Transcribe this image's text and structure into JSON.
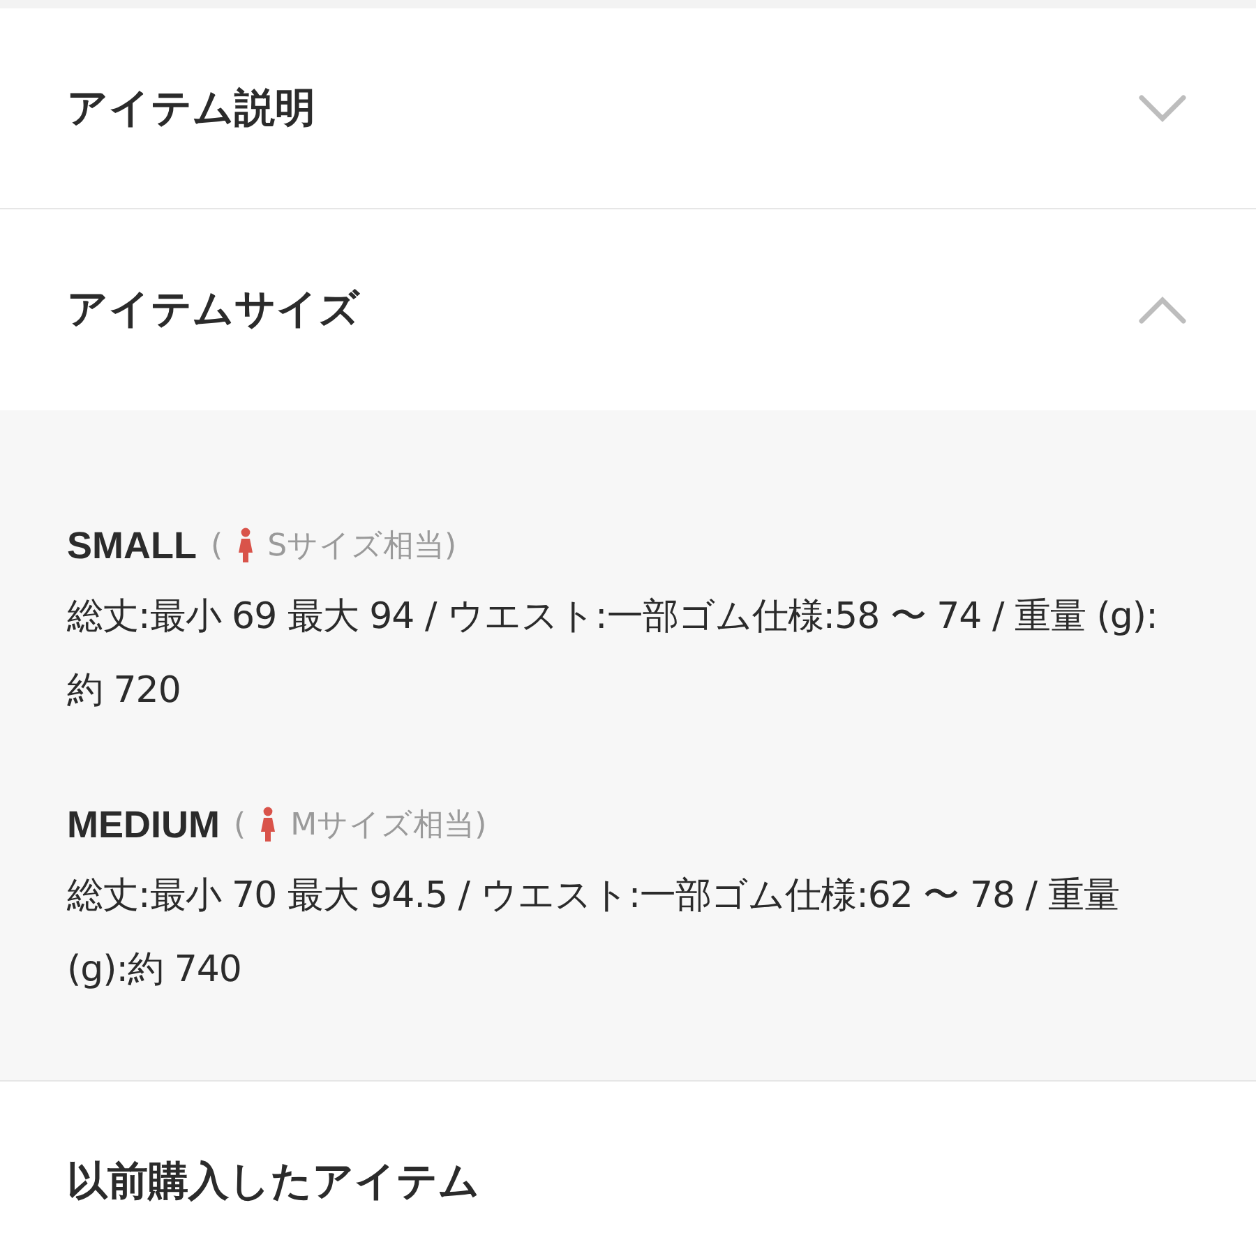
{
  "sections": [
    {
      "title": "アイテム説明",
      "expanded": false
    },
    {
      "title": "アイテムサイズ",
      "expanded": true,
      "sizes": [
        {
          "name": "SMALL",
          "note_open": "(",
          "note": "Sサイズ相当)",
          "details": "総丈:最小 69 最大 94 / ウエスト:一部ゴム仕様:58 〜 74 / 重量 (g):約 720"
        },
        {
          "name": "MEDIUM",
          "note_open": "(",
          "note": "Mサイズ相当)",
          "details": "総丈:最小 70 最大 94.5 / ウエスト:一部ゴム仕様:62 〜 78 / 重量 (g):約 740"
        }
      ]
    },
    {
      "title": "以前購入したアイテム"
    }
  ]
}
